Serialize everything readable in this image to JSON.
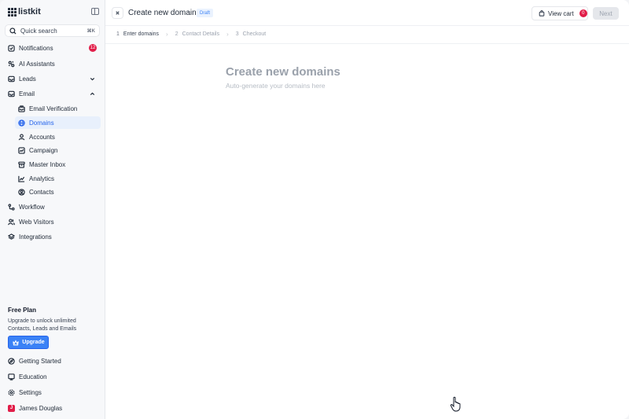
{
  "sidebar": {
    "brand": "listkit",
    "search": {
      "label": "Quick search",
      "shortcut": "⌘K"
    },
    "items": [
      {
        "label": "Notifications",
        "icon": "checkbox-icon",
        "badge": "12"
      },
      {
        "label": "AI Assistants",
        "icon": "sparkles-icon"
      },
      {
        "label": "Leads",
        "icon": "inbox-icon"
      },
      {
        "label": "Email",
        "icon": "mail-icon"
      }
    ],
    "email_sub_items": [
      {
        "label": "Email Verification",
        "icon": "mailbox-icon"
      },
      {
        "label": "Domains",
        "icon": "globe-icon",
        "active": true
      },
      {
        "label": "Accounts",
        "icon": "users-icon"
      },
      {
        "label": "Campaign",
        "icon": "campaign-icon"
      },
      {
        "label": "Master Inbox",
        "icon": "archive-icon"
      },
      {
        "label": "Analytics",
        "icon": "chart-icon"
      },
      {
        "label": "Contacts",
        "icon": "contact-icon"
      }
    ],
    "bottom_items": [
      {
        "label": "Workflow",
        "icon": "workflow-icon"
      },
      {
        "label": "Web Visitors",
        "icon": "visitors-icon"
      },
      {
        "label": "Integrations",
        "icon": "layers-icon"
      }
    ],
    "plan": {
      "title": "Free Plan",
      "description": "Upgrade to unlock unlimited Contacts, Leads and Emails",
      "upgrade_label": "Upgrade"
    },
    "footer_items": [
      {
        "label": "Getting Started",
        "icon": "compass-icon"
      },
      {
        "label": "Education",
        "icon": "education-icon"
      },
      {
        "label": "Settings",
        "icon": "gear-icon"
      }
    ],
    "user": {
      "initial": "J",
      "name": "James Douglas"
    }
  },
  "header": {
    "title": "Create new domains",
    "status": "Draft",
    "cart_label": "View cart",
    "cart_count": "0",
    "next_label": "Next"
  },
  "stepper": [
    {
      "num": "1",
      "label": "Enter domains",
      "current": true
    },
    {
      "num": "2",
      "label": "Contact Details"
    },
    {
      "num": "3",
      "label": "Checkout"
    }
  ],
  "main": {
    "title": "Create new domains",
    "subtitle": "Auto-generate your domains here"
  },
  "colors": {
    "accent": "#3b82f6",
    "badge": "#e11d48",
    "active_bg": "#e8f0fc"
  }
}
